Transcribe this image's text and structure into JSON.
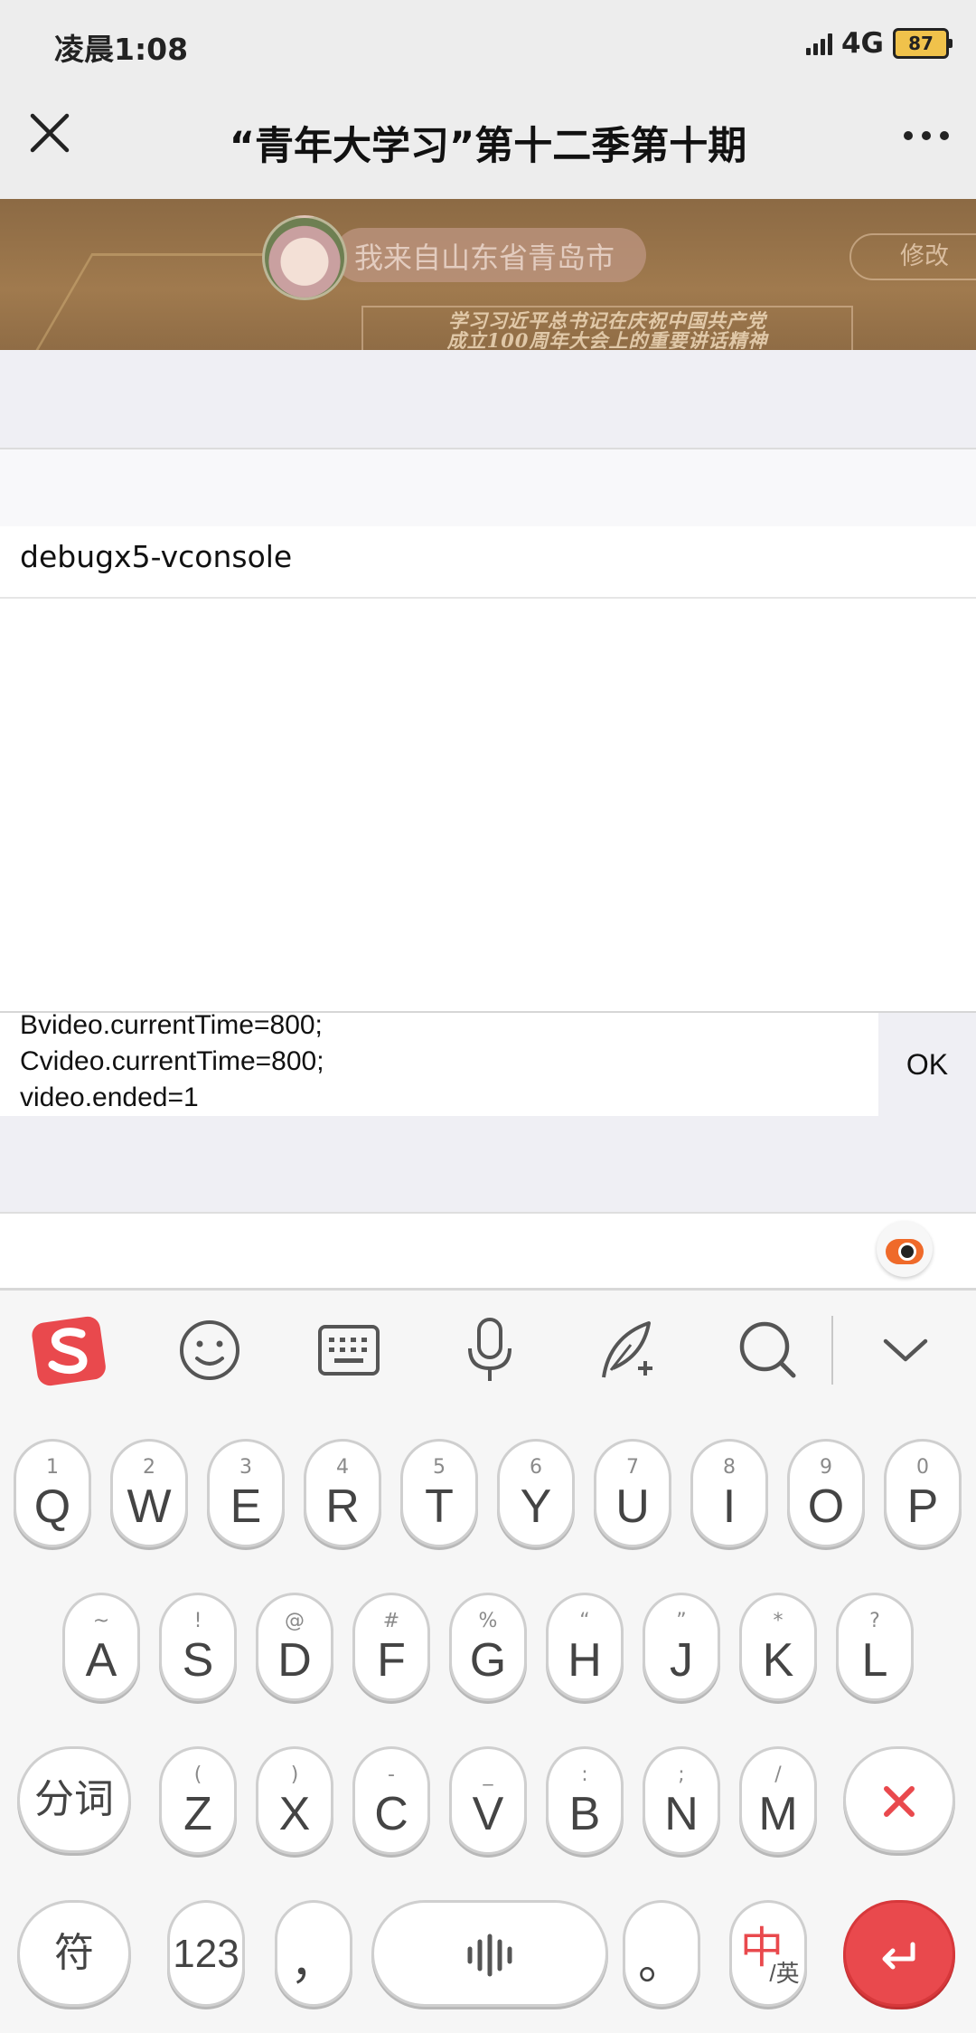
{
  "status_bar": {
    "time": "凌晨1:08",
    "network": "4G",
    "battery": "87"
  },
  "nav": {
    "title": "“青年大学习”第十二季第十期",
    "close_icon": "close-icon",
    "more_icon": "more-dots-icon"
  },
  "banner": {
    "location": "我来自山东省青岛市",
    "edit_label": "修改",
    "slogan_line1": "学习习近平总书记在庆祝中国共产党",
    "slogan_line2": "成立100周年大会上的重要讲话精神"
  },
  "console": {
    "tab_label": "debugx5-vconsole",
    "command_lines": "Bvideo.currentTime=800;\nCvideo.currentTime=800;\nvideo.ended=1",
    "ok_label": "OK"
  },
  "keyboard": {
    "toolbar": [
      "sogou-logo-icon",
      "emoji-icon",
      "keyboard-icon",
      "microphone-icon",
      "handwriting-icon",
      "search-icon",
      "collapse-chevron-icon"
    ],
    "row1": [
      {
        "main": "Q",
        "sub": "1"
      },
      {
        "main": "W",
        "sub": "2"
      },
      {
        "main": "E",
        "sub": "3"
      },
      {
        "main": "R",
        "sub": "4"
      },
      {
        "main": "T",
        "sub": "5"
      },
      {
        "main": "Y",
        "sub": "6"
      },
      {
        "main": "U",
        "sub": "7"
      },
      {
        "main": "I",
        "sub": "8"
      },
      {
        "main": "O",
        "sub": "9"
      },
      {
        "main": "P",
        "sub": "0"
      }
    ],
    "row2": [
      {
        "main": "A",
        "sub": "~"
      },
      {
        "main": "S",
        "sub": "!"
      },
      {
        "main": "D",
        "sub": "@"
      },
      {
        "main": "F",
        "sub": "#"
      },
      {
        "main": "G",
        "sub": "%"
      },
      {
        "main": "H",
        "sub": "“"
      },
      {
        "main": "J",
        "sub": "”"
      },
      {
        "main": "K",
        "sub": "*"
      },
      {
        "main": "L",
        "sub": "?"
      }
    ],
    "row3_left": "分词",
    "row3": [
      {
        "main": "Z",
        "sub": "("
      },
      {
        "main": "X",
        "sub": ")"
      },
      {
        "main": "C",
        "sub": "-"
      },
      {
        "main": "V",
        "sub": "_"
      },
      {
        "main": "B",
        "sub": ":"
      },
      {
        "main": "N",
        "sub": ";"
      },
      {
        "main": "M",
        "sub": "/"
      }
    ],
    "row4": {
      "symbols": "符",
      "numbers": "123",
      "comma": "，",
      "period": "。",
      "lang_main": "中",
      "lang_sub": "/英"
    },
    "accent": "#e9494d"
  }
}
